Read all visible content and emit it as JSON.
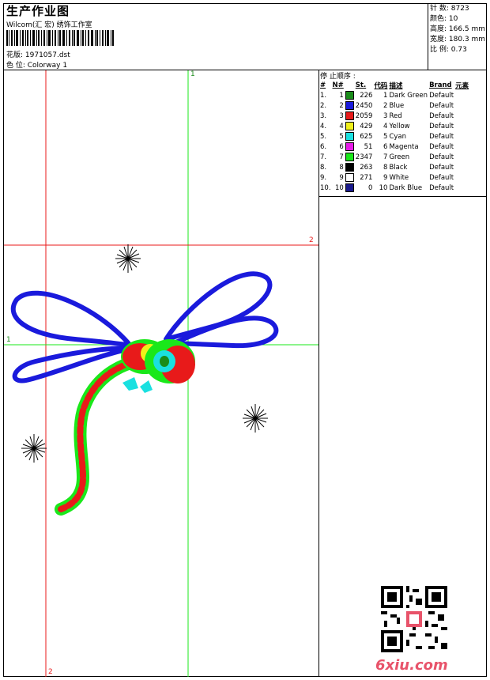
{
  "header": {
    "title": "生产作业图",
    "software": "Wilcom(汇 宏) 绣饰工作室",
    "design_label": "花版: 1971057.dst",
    "colorway_label": "色 位:  Colorway 1"
  },
  "stats": {
    "stitches": "针 数: 8723",
    "colors": "颜色: 10",
    "height": "高度: 166.5 mm",
    "width": "宽度: 180.3 mm",
    "scale": "比 例: 0.73"
  },
  "guides": {
    "v1_top": "1",
    "v2_bottom": "2",
    "h1_left": "1",
    "h2_right": "2"
  },
  "stop_sequence": {
    "title": "停 止顺序 :",
    "headers": [
      "#",
      "N#",
      "St.",
      "代码",
      "描述",
      "Brand",
      "元素"
    ],
    "rows": [
      {
        "idx": "1.",
        "n": "1",
        "st": "226",
        "code": "1",
        "desc": "Dark Green",
        "brand": "Default",
        "color": "#1a8c1a"
      },
      {
        "idx": "2.",
        "n": "2",
        "st": "2450",
        "code": "2",
        "desc": "Blue",
        "brand": "Default",
        "color": "#1a1adc"
      },
      {
        "idx": "3.",
        "n": "3",
        "st": "2059",
        "code": "3",
        "desc": "Red",
        "brand": "Default",
        "color": "#e81a1a"
      },
      {
        "idx": "4.",
        "n": "4",
        "st": "429",
        "code": "4",
        "desc": "Yellow",
        "brand": "Default",
        "color": "#f0f01a"
      },
      {
        "idx": "5.",
        "n": "5",
        "st": "625",
        "code": "5",
        "desc": "Cyan",
        "brand": "Default",
        "color": "#1ae0e0"
      },
      {
        "idx": "6.",
        "n": "6",
        "st": "51",
        "code": "6",
        "desc": "Magenta",
        "brand": "Default",
        "color": "#e81ae8"
      },
      {
        "idx": "7.",
        "n": "7",
        "st": "2347",
        "code": "7",
        "desc": "Green",
        "brand": "Default",
        "color": "#1ae81a"
      },
      {
        "idx": "8.",
        "n": "8",
        "st": "263",
        "code": "8",
        "desc": "Black",
        "brand": "Default",
        "color": "#000000"
      },
      {
        "idx": "9.",
        "n": "9",
        "st": "271",
        "code": "9",
        "desc": "White",
        "brand": "Default",
        "color": "#ffffff"
      },
      {
        "idx": "10.",
        "n": "10",
        "st": "0",
        "code": "10",
        "desc": "Dark Blue",
        "brand": "Default",
        "color": "#1a1a8c"
      }
    ]
  },
  "watermark": "6xiu.com",
  "qr_icon": "qr-code-icon"
}
